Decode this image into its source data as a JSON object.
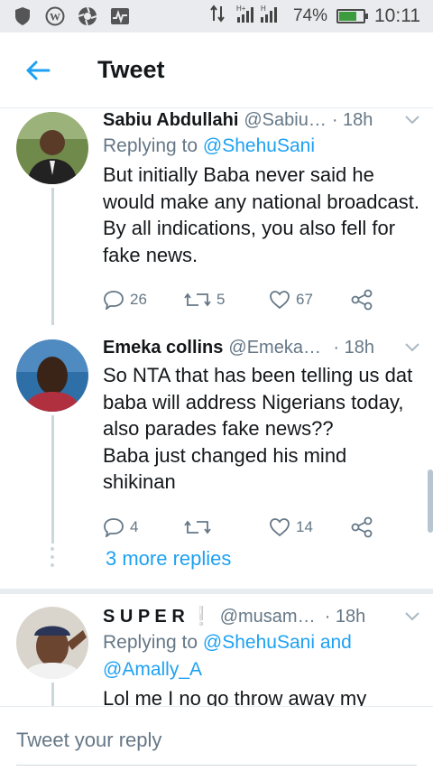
{
  "status_bar": {
    "time": "10:11",
    "battery": "74%",
    "battery_fraction": 0.74,
    "network": "H+",
    "icons": [
      "shield-icon",
      "wordpress-icon",
      "aperture-icon",
      "activity-icon"
    ]
  },
  "header": {
    "title": "Tweet"
  },
  "tweets": [
    {
      "name": "Sabiu Abdullahi",
      "handle": "@Sabiu…",
      "time": "· 18h",
      "reply_prefix": "Replying to ",
      "reply_to": "@ShehuSani",
      "text": "But initially Baba never said he would make any national broadcast. By all indications, you also fell for fake news.",
      "replies": "26",
      "retweets": "5",
      "likes": "67"
    },
    {
      "name": "Emeka collins",
      "handle": "@Emekac…",
      "time": "· 18h",
      "text_lines": [
        "So NTA that has been telling us dat",
        "baba will address Nigerians today,",
        "also parades fake news??",
        "Baba just changed his mind",
        "shikinan"
      ],
      "replies": "4",
      "retweets": "",
      "likes": "14"
    },
    {
      "name": "S U P E R",
      "badge": "❕",
      "handle": "@musamukt…",
      "time": "· 18h",
      "reply_prefix": "Replying to ",
      "reply_to": "@ShehuSani and",
      "reply_to_2": "@Amally_A",
      "text_partial": "Lol me I no go throw away my"
    }
  ],
  "more_replies": "3 more replies",
  "reply_placeholder": "Tweet your reply",
  "colors": {
    "accent": "#1da1f2",
    "muted": "#657786",
    "text": "#14171a"
  }
}
